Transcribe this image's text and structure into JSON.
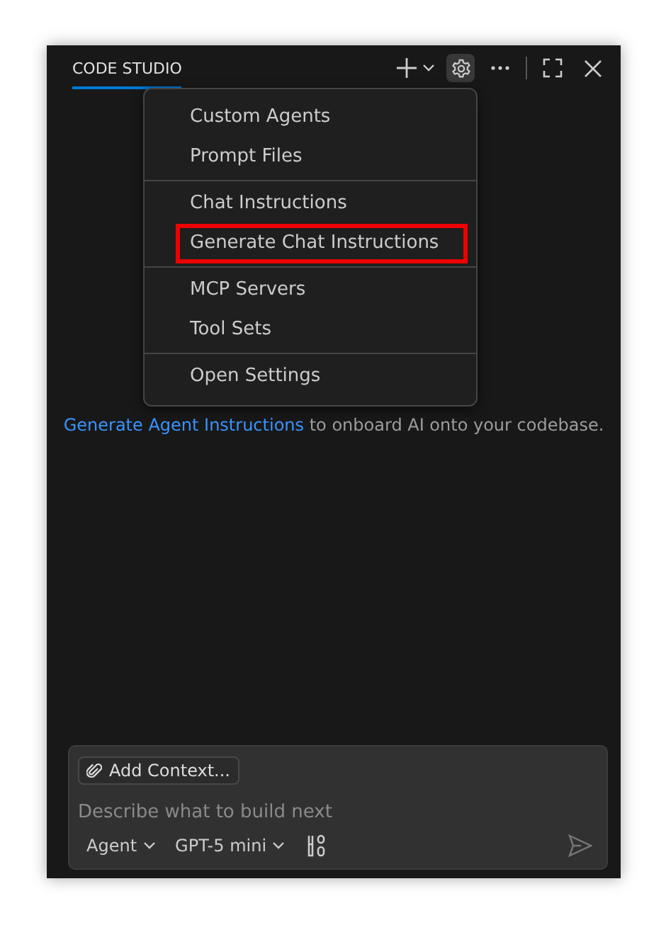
{
  "header": {
    "tab": {
      "label": "CODE STUDIO",
      "selected": true
    }
  },
  "menu": {
    "groups": [
      {
        "items": [
          {
            "label": "Custom Agents",
            "highlighted": false
          },
          {
            "label": "Prompt Files",
            "highlighted": false
          }
        ]
      },
      {
        "items": [
          {
            "label": "Chat Instructions",
            "highlighted": false
          },
          {
            "label": "Generate Chat Instructions",
            "highlighted": true
          }
        ]
      },
      {
        "items": [
          {
            "label": "MCP Servers",
            "highlighted": false
          },
          {
            "label": "Tool Sets",
            "highlighted": false
          }
        ]
      },
      {
        "items": [
          {
            "label": "Open Settings",
            "highlighted": false
          }
        ]
      }
    ]
  },
  "intro": {
    "link": "Generate Agent Instructions",
    "text": "to onboard AI onto your codebase."
  },
  "composer": {
    "context_button": "Add Context...",
    "placeholder": "Describe what to build next",
    "mode": "Agent",
    "model": "GPT-5 mini"
  }
}
